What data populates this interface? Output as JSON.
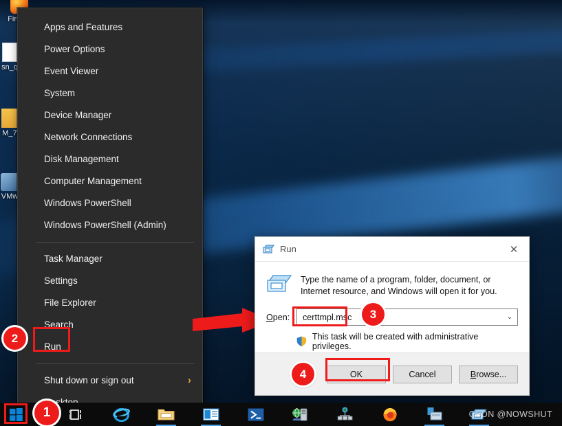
{
  "desktop": {
    "icons": [
      {
        "label": "Firefox",
        "glyph": "firefox-icon"
      },
      {
        "label": "sn_q",
        "glyph": "document-icon"
      },
      {
        "label": "M_7",
        "glyph": "note-icon"
      },
      {
        "label": "VMw",
        "glyph": "vmware-icon"
      }
    ]
  },
  "winx_menu": {
    "title": "Windows power user menu",
    "items": [
      {
        "label": "Apps and Features",
        "submenu": false
      },
      {
        "label": "Power Options",
        "submenu": false
      },
      {
        "label": "Event Viewer",
        "submenu": false
      },
      {
        "label": "System",
        "submenu": false
      },
      {
        "label": "Device Manager",
        "submenu": false
      },
      {
        "label": "Network Connections",
        "submenu": false
      },
      {
        "label": "Disk Management",
        "submenu": false
      },
      {
        "label": "Computer Management",
        "submenu": false
      },
      {
        "label": "Windows PowerShell",
        "submenu": false
      },
      {
        "label": "Windows PowerShell (Admin)",
        "submenu": false
      },
      {
        "label": "Task Manager",
        "submenu": false
      },
      {
        "label": "Settings",
        "submenu": false
      },
      {
        "label": "File Explorer",
        "submenu": false
      },
      {
        "label": "Search",
        "submenu": false
      },
      {
        "label": "Run",
        "submenu": false
      },
      {
        "label": "Shut down or sign out",
        "submenu": true,
        "chevron": "›"
      },
      {
        "label": "Desktop",
        "submenu": false
      }
    ]
  },
  "run_dialog": {
    "title": "Run",
    "close_label": "✕",
    "description": "Type the name of a program, folder, document, or Internet resource, and Windows will open it for you.",
    "open_label_pre": "O",
    "open_label_post": "pen:",
    "open_value": "certtmpl.msc",
    "open_placeholder": "",
    "dropdown_glyph": "⌄",
    "uac_text": "This task will be created with administrative privileges.",
    "buttons": {
      "ok": "OK",
      "cancel": "Cancel",
      "browse_pre": "B",
      "browse_post": "rowse..."
    }
  },
  "annotations": {
    "badges": [
      {
        "id": "1",
        "label": "1"
      },
      {
        "id": "2",
        "label": "2"
      },
      {
        "id": "3",
        "label": "3"
      },
      {
        "id": "4",
        "label": "4"
      }
    ],
    "arrow_color": "#ee1b1b",
    "highlight_color": "#ee1b1b"
  },
  "taskbar": {
    "start_label": "Start",
    "items": [
      {
        "name": "task-view-icon",
        "label": "Task View",
        "active": false
      },
      {
        "name": "internet-explorer-icon",
        "label": "Internet Explorer",
        "active": false
      },
      {
        "name": "file-explorer-icon",
        "label": "File Explorer",
        "active": true
      },
      {
        "name": "outlook-icon",
        "label": "Mail",
        "active": true
      },
      {
        "name": "powershell-icon",
        "label": "Windows PowerShell",
        "active": false
      },
      {
        "name": "server-manager-icon",
        "label": "Server Manager",
        "active": false
      },
      {
        "name": "network-map-icon",
        "label": "Network",
        "active": false
      },
      {
        "name": "firefox-icon",
        "label": "Firefox",
        "active": false
      },
      {
        "name": "remote-desktop-icon",
        "label": "Remote Desktop",
        "active": true
      },
      {
        "name": "run-window-icon",
        "label": "Run",
        "active": true
      }
    ],
    "watermark": "CSDN @NOWSHUT"
  }
}
